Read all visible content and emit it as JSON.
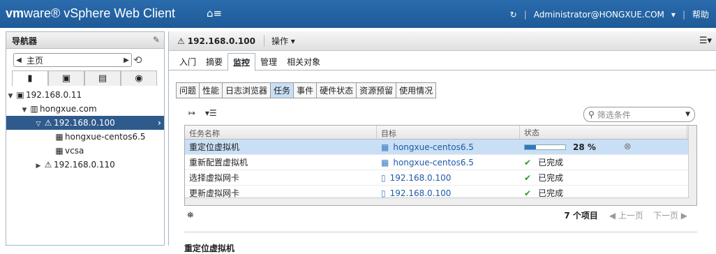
{
  "topbar": {
    "brand_vm": "vm",
    "brand_rest": "ware® vSphere Web Client",
    "home_icon": "home-icon",
    "refresh_icon": "refresh-icon",
    "user": "Administrator@HONGXUE.COM",
    "help": "帮助"
  },
  "navigator": {
    "title": "导航器",
    "home_label": "主页",
    "tabs": [
      "hosts-clusters-icon",
      "vms-templates-icon",
      "storage-icon",
      "network-icon"
    ],
    "tree": [
      {
        "label": "192.168.0.11",
        "icon": "datacenter-icon"
      },
      {
        "label": "hongxue.com",
        "icon": "folder-icon"
      },
      {
        "label": "192.168.0.100",
        "icon": "host-warning-icon"
      },
      {
        "label": "hongxue-centos6.5",
        "icon": "vm-icon"
      },
      {
        "label": "vcsa",
        "icon": "vm-icon"
      },
      {
        "label": "192.168.0.110",
        "icon": "host-warning-icon"
      }
    ]
  },
  "main": {
    "host": "192.168.0.100",
    "actions": "操作 ▾",
    "tabs": [
      "入门",
      "摘要",
      "监控",
      "管理",
      "相关对象"
    ],
    "subtabs": [
      "问题",
      "性能",
      "日志浏览器",
      "任务",
      "事件",
      "硬件状态",
      "资源预留",
      "使用情况"
    ],
    "filter_placeholder": "筛选条件",
    "columns": [
      "任务名称",
      "目标",
      "状态"
    ],
    "rows": [
      {
        "name": "重定位虚拟机",
        "target": "hongxue-centos6.5",
        "status": "28 %"
      },
      {
        "name": "重新配置虚拟机",
        "target": "hongxue-centos6.5",
        "status": "已完成"
      },
      {
        "name": "选择虚拟网卡",
        "target": "192.168.0.100",
        "status": "已完成"
      },
      {
        "name": "更新虚拟网卡",
        "target": "192.168.0.100",
        "status": "已完成"
      }
    ],
    "progress": 0.28,
    "count": "7 个项目",
    "prev": "上一页",
    "next": "下一页",
    "detail_title": "重定位虚拟机"
  }
}
